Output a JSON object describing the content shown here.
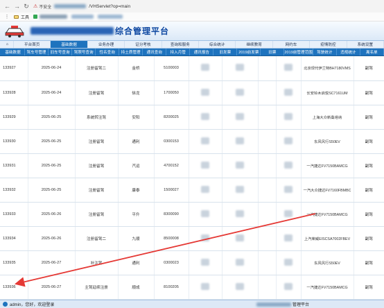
{
  "browser": {
    "insecure_label": "不安全",
    "url_suffix": "/VHServlet?op=main",
    "bookmark_tools": "工具"
  },
  "app": {
    "title_suffix": "综合管理平台"
  },
  "menu_main": [
    {
      "label": "平台首页",
      "active": false
    },
    {
      "label": "基础数据",
      "active": true
    },
    {
      "label": "业务办理",
      "active": false
    },
    {
      "label": "证分考核",
      "active": false
    },
    {
      "label": "查询和服务",
      "active": false
    },
    {
      "label": "综合统计",
      "active": false
    },
    {
      "label": "继续教育",
      "active": false
    },
    {
      "label": "网约车",
      "active": false
    },
    {
      "label": "疫情防控",
      "active": false
    },
    {
      "label": "系统设置",
      "active": false
    }
  ],
  "menu_sub": [
    "基础数据",
    "驾车号管理",
    "旧车号查询",
    "驾照号查询",
    "性名查询",
    "持土质管理",
    "通讯查询",
    "持入月管",
    "通讯报告",
    "旧发票",
    "2019前发票",
    "旧票",
    "2019前管理范围",
    "驾驶统计",
    "违规统计",
    "离名单"
  ],
  "rows": [
    {
      "id": "133927",
      "date": "2025-06-24",
      "type": "注册留驾二",
      "region": "金桥",
      "num": "5100003",
      "model": "北京现代伊兰特BH7180VMS",
      "action": "副驾"
    },
    {
      "id": "133928",
      "date": "2025-06-24",
      "type": "注册留驾",
      "region": "徐龙",
      "num": "1700050",
      "model": "长安铃木启悦SC7161UM",
      "action": "副驾"
    },
    {
      "id": "133929",
      "date": "2025-06-25",
      "type": "系统转注驾",
      "region": "安阳",
      "num": "8200025",
      "model": "上海大众新桑塔纳",
      "action": "副驾"
    },
    {
      "id": "133930",
      "date": "2025-06-25",
      "type": "注册留驾",
      "region": "通利",
      "num": "0300153",
      "model": "东风风行S50EV",
      "action": "副驾"
    },
    {
      "id": "133931",
      "date": "2025-06-25",
      "type": "注册留驾",
      "region": "汽运",
      "num": "4700152",
      "model": "一汽捷达FV7150BAMCG",
      "action": "副驾"
    },
    {
      "id": "133932",
      "date": "2025-06-25",
      "type": "注册留驾",
      "region": "康泰",
      "num": "1500027",
      "model": "一汽大众捷达FV7160FBMBC",
      "action": "副驾"
    },
    {
      "id": "133933",
      "date": "2025-06-26",
      "type": "注册留驾",
      "region": "平升",
      "num": "8300090",
      "model": "一汽捷达FV7150BAMCG",
      "action": "副驾"
    },
    {
      "id": "133934",
      "date": "2025-06-26",
      "type": "注册留驾二",
      "region": "九顺",
      "num": "8500008",
      "model": "上汽荣威EISCSA7002FBEV",
      "action": "副驾"
    },
    {
      "id": "133935",
      "date": "2025-06-27",
      "type": "补注驾",
      "region": "通利",
      "num": "0300023",
      "model": "东风风行S50EV",
      "action": "副驾"
    },
    {
      "id": "133936",
      "date": "2025-06-27",
      "type": "主驾延续注册",
      "region": "顺成",
      "num": "8100205",
      "model": "一汽捷达FV7150BAMCG",
      "action": "副驾"
    }
  ],
  "footer": {
    "user_text": "admin，您好，欢迎登录",
    "title_suffix": "管理平台"
  },
  "colors": {
    "accent": "#1e73be",
    "title": "#0d47a1",
    "annotation": "#e53935"
  }
}
